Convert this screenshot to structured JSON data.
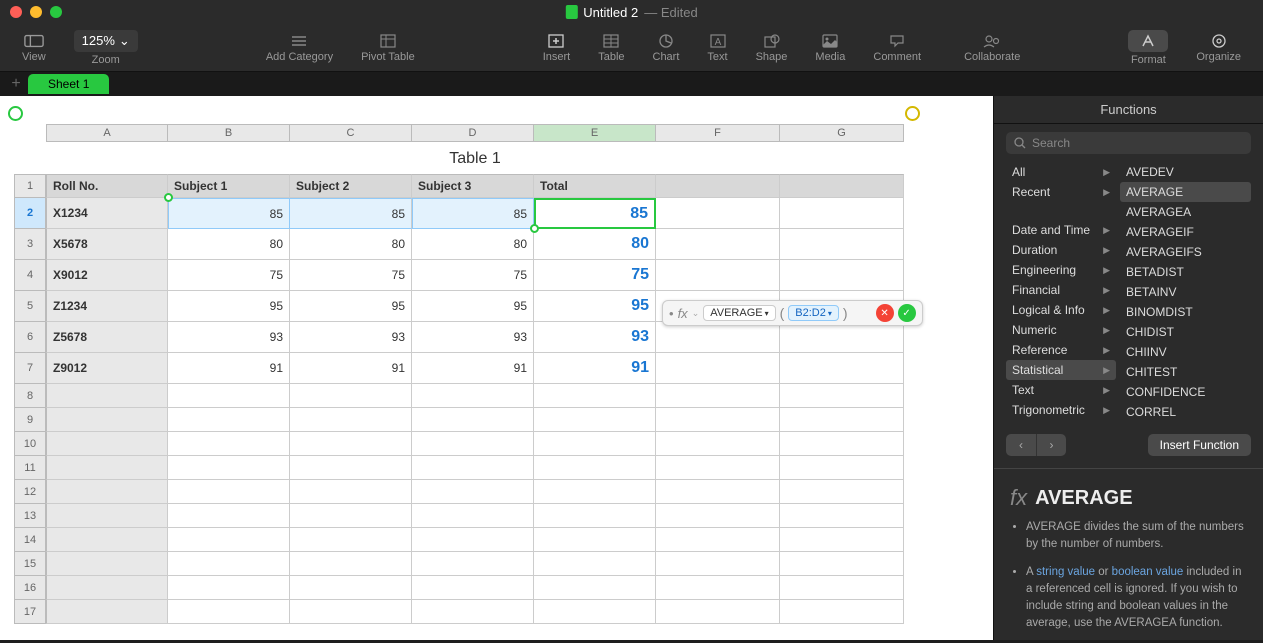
{
  "window": {
    "title": "Untitled 2",
    "status": "— Edited"
  },
  "toolbar": {
    "view": "View",
    "zoom_label": "Zoom",
    "zoom_value": "125%",
    "add_category": "Add Category",
    "pivot_table": "Pivot Table",
    "insert": "Insert",
    "table": "Table",
    "chart": "Chart",
    "text": "Text",
    "shape": "Shape",
    "media": "Media",
    "comment": "Comment",
    "collaborate": "Collaborate",
    "format": "Format",
    "organize": "Organize"
  },
  "sheet": {
    "tab": "Sheet 1",
    "table_title": "Table 1",
    "columns": [
      "A",
      "B",
      "C",
      "D",
      "E",
      "F",
      "G"
    ],
    "headers": {
      "a": "Roll No.",
      "b": "Subject 1",
      "c": "Subject 2",
      "d": "Subject 3",
      "e": "Total"
    },
    "rows": [
      {
        "roll": "X1234",
        "s1": "85",
        "s2": "85",
        "s3": "85",
        "total": "85"
      },
      {
        "roll": "X5678",
        "s1": "80",
        "s2": "80",
        "s3": "80",
        "total": "80"
      },
      {
        "roll": "X9012",
        "s1": "75",
        "s2": "75",
        "s3": "75",
        "total": "75"
      },
      {
        "roll": "Z1234",
        "s1": "95",
        "s2": "95",
        "s3": "95",
        "total": "95"
      },
      {
        "roll": "Z5678",
        "s1": "93",
        "s2": "93",
        "s3": "93",
        "total": "93"
      },
      {
        "roll": "Z9012",
        "s1": "91",
        "s2": "91",
        "s3": "91",
        "total": "91"
      }
    ],
    "row_nums": [
      "1",
      "2",
      "3",
      "4",
      "5",
      "6",
      "7",
      "8",
      "9",
      "10",
      "11",
      "12",
      "13",
      "14",
      "15",
      "16",
      "17"
    ]
  },
  "formula": {
    "fn": "AVERAGE",
    "ref": "B2:D2"
  },
  "panel": {
    "title": "Functions",
    "search_placeholder": "Search",
    "categories": [
      "All",
      "Recent",
      "",
      "Date and Time",
      "Duration",
      "Engineering",
      "Financial",
      "Logical & Info",
      "Numeric",
      "Reference",
      "Statistical",
      "Text",
      "Trigonometric"
    ],
    "selected_category": "Statistical",
    "functions": [
      "AVEDEV",
      "AVERAGE",
      "AVERAGEA",
      "AVERAGEIF",
      "AVERAGEIFS",
      "BETADIST",
      "BETAINV",
      "BINOMDIST",
      "CHIDIST",
      "CHIINV",
      "CHITEST",
      "CONFIDENCE",
      "CORREL"
    ],
    "selected_function": "AVERAGE",
    "insert_btn": "Insert Function",
    "detail_name": "AVERAGE",
    "desc1": "AVERAGE divides the sum of the numbers by the number of numbers.",
    "desc2_a": "A ",
    "desc2_link1": "string value",
    "desc2_b": " or ",
    "desc2_link2": "boolean value",
    "desc2_c": " included in a referenced cell is ignored. If you wish to include string and boolean values in the average, use the AVERAGEA function."
  }
}
